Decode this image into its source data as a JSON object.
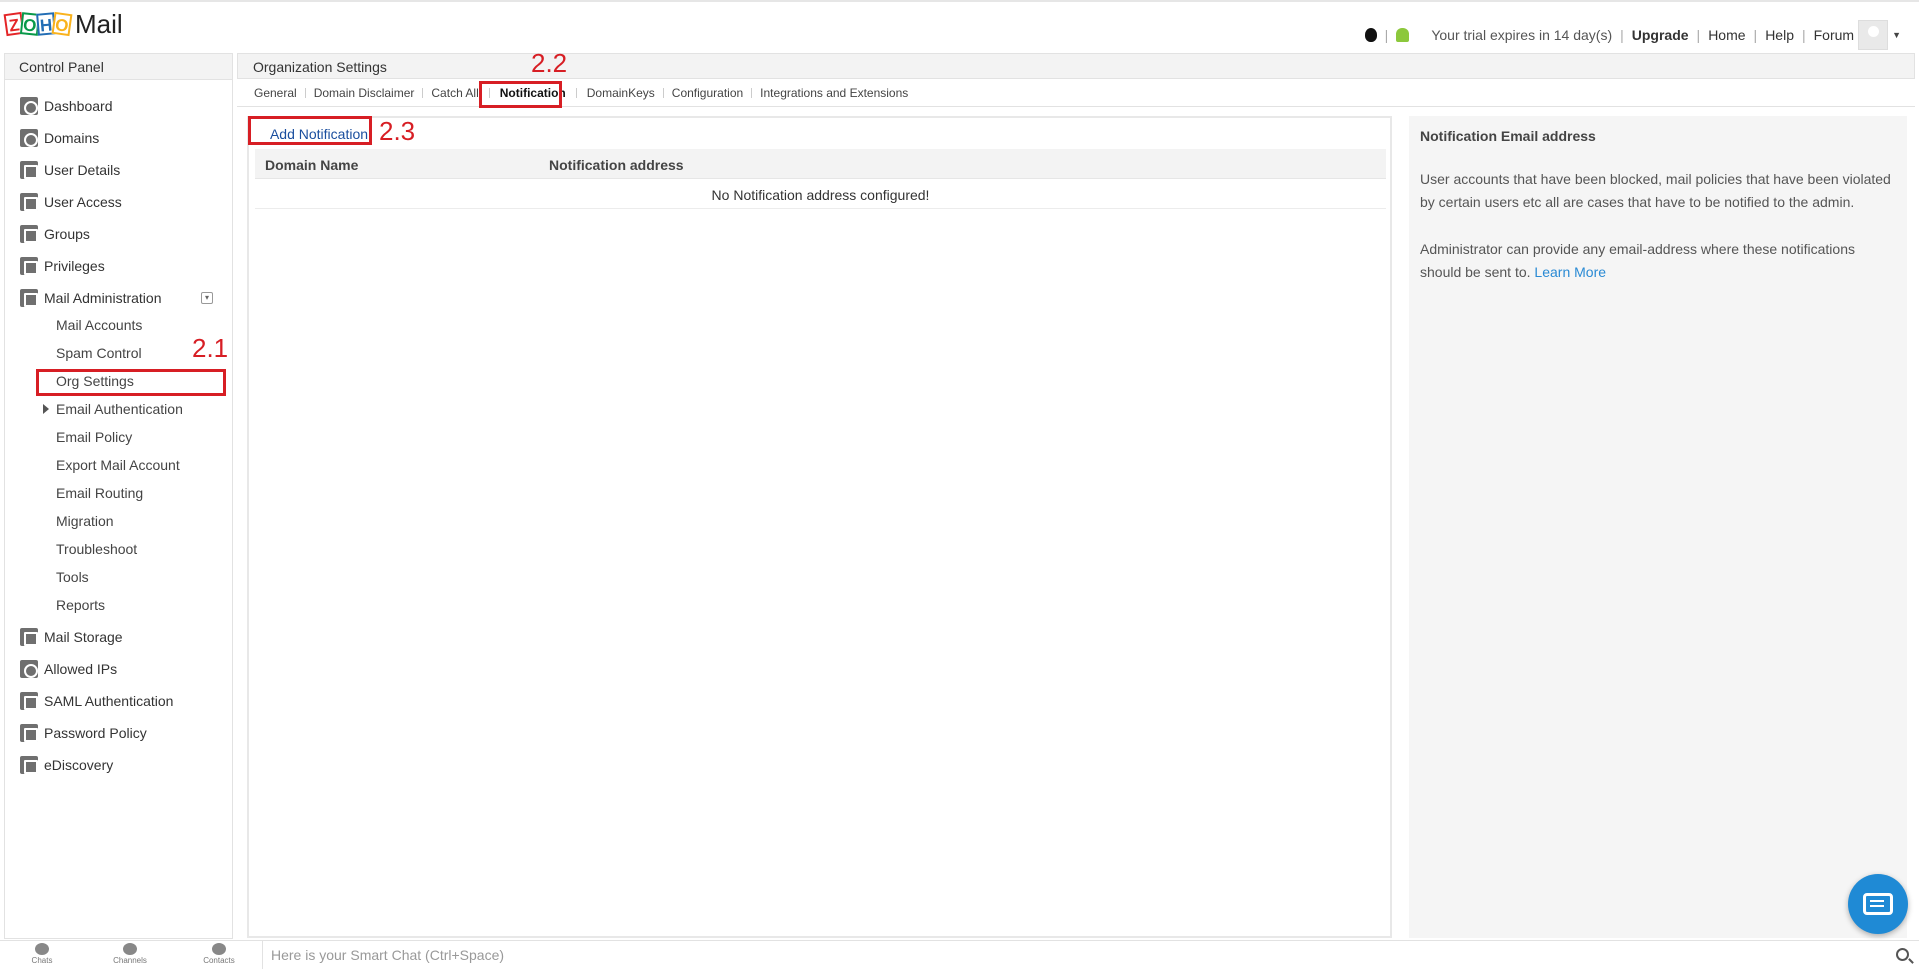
{
  "header": {
    "logo_text": "Mail",
    "trial_text": "Your trial expires in 14 day(s)",
    "upgrade": "Upgrade",
    "home": "Home",
    "help": "Help",
    "forum": "Forum"
  },
  "sidebar": {
    "title": "Control Panel",
    "items": [
      {
        "label": "Dashboard",
        "icon": "dashboard-icon"
      },
      {
        "label": "Domains",
        "icon": "globe-icon"
      },
      {
        "label": "User Details",
        "icon": "user-icon"
      },
      {
        "label": "User Access",
        "icon": "user-lock-icon"
      },
      {
        "label": "Groups",
        "icon": "group-icon"
      },
      {
        "label": "Privileges",
        "icon": "document-icon"
      },
      {
        "label": "Mail Administration",
        "icon": "mail-icon"
      }
    ],
    "mail_admin_sub": [
      "Mail Accounts",
      "Spam Control",
      "Org Settings",
      "Email Authentication",
      "Email Policy",
      "Export Mail Account",
      "Email Routing",
      "Migration",
      "Troubleshoot",
      "Tools",
      "Reports"
    ],
    "items_after": [
      {
        "label": "Mail Storage",
        "icon": "storage-icon"
      },
      {
        "label": "Allowed IPs",
        "icon": "ip-icon"
      },
      {
        "label": "SAML Authentication",
        "icon": "monitor-icon"
      },
      {
        "label": "Password Policy",
        "icon": "lock-icon"
      },
      {
        "label": "eDiscovery",
        "icon": "ediscovery-icon"
      }
    ]
  },
  "main": {
    "title": "Organization Settings",
    "tabs": [
      "General",
      "Domain Disclaimer",
      "Catch All",
      "Notification",
      "DomainKeys",
      "Configuration",
      "Integrations and Extensions"
    ],
    "active_tab": "Notification",
    "add_button": "Add Notification",
    "columns": [
      "Domain Name",
      "Notification address"
    ],
    "empty_message": "No Notification address configured!"
  },
  "help": {
    "title": "Notification Email address",
    "p1": "User accounts that have been blocked, mail policies that have been violated by certain users etc all are cases that have to be notified to the admin.",
    "p2": "Administrator can provide any email-address where these notifications should be sent to.",
    "learn_more": "Learn More"
  },
  "annotations": {
    "a1": "2.1",
    "a2": "2.2",
    "a3": "2.3"
  },
  "bottombar": {
    "chats": "Chats",
    "channels": "Channels",
    "contacts": "Contacts",
    "smart_chat_placeholder": "Here is your Smart Chat (Ctrl+Space)"
  },
  "colors": {
    "annotation_red": "#d71e24",
    "link_blue": "#2a8ad4",
    "fab_blue": "#1f8ad5"
  }
}
